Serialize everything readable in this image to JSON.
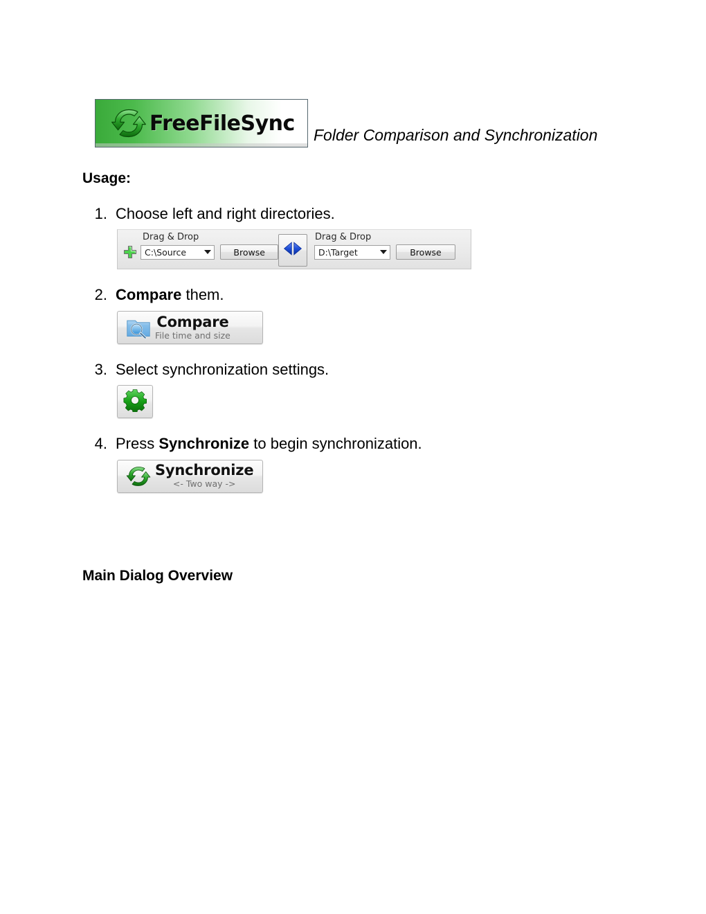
{
  "document": {
    "logo": {
      "brand_text": "FreeFileSync",
      "icon": "sync-arrows-icon"
    },
    "tagline": "Folder Comparison and Synchronization",
    "usage_heading": "Usage:",
    "overview_heading": "Main Dialog Overview"
  },
  "steps": [
    {
      "number": "1.",
      "text_plain": "Choose left and right directories.",
      "text_before": "Choose left and right directories.",
      "bold": "",
      "text_after": ""
    },
    {
      "number": "2.",
      "text_plain": "Compare them.",
      "text_before": "",
      "bold": "Compare",
      "text_after": " them."
    },
    {
      "number": "3.",
      "text_plain": "Select synchronization settings.",
      "text_before": "Select synchronization settings.",
      "bold": "",
      "text_after": ""
    },
    {
      "number": "4.",
      "text_plain": "Press Synchronize to begin synchronization.",
      "text_before": "Press ",
      "bold": "Synchronize",
      "text_after": " to begin synchronization."
    }
  ],
  "dnd_panel": {
    "left": {
      "label": "Drag & Drop",
      "path_value": "C:\\Source",
      "browse_label": "Browse",
      "add_icon": "plus-icon"
    },
    "right": {
      "label": "Drag & Drop",
      "path_value": "D:\\Target",
      "browse_label": "Browse"
    },
    "swap_icon": "swap-left-right-arrows-icon"
  },
  "compare_button": {
    "title": "Compare",
    "subtitle": "File time and size",
    "icon": "folder-magnifier-icon"
  },
  "settings_button": {
    "icon": "green-gear-icon"
  },
  "synchronize_button": {
    "title": "Synchronize",
    "subtitle": "<- Two way ->",
    "icon": "green-sync-arrows-icon"
  },
  "colors": {
    "brand_green": "#3aaa3a",
    "accent_blue": "#1f4fd8",
    "text": "#000000",
    "muted_text": "#6e6e6e"
  }
}
